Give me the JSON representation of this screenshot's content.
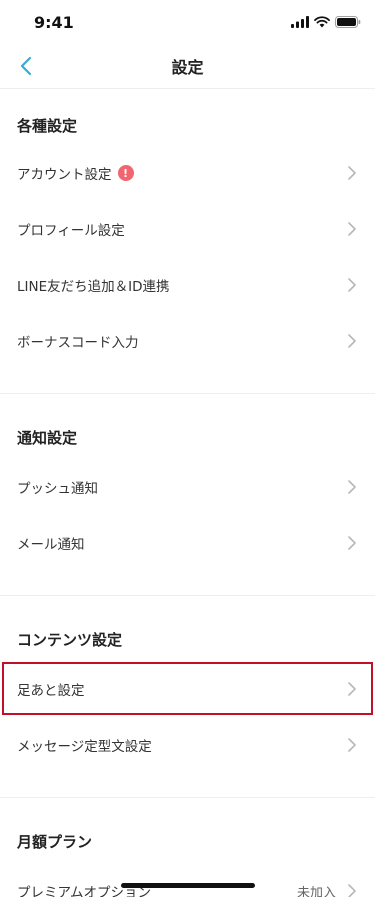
{
  "status_bar": {
    "time": "9:41"
  },
  "nav": {
    "title": "設定"
  },
  "sections": {
    "various": {
      "title": "各種設定",
      "items": [
        {
          "label": "アカウント設定",
          "alert": "!"
        },
        {
          "label": "プロフィール設定"
        },
        {
          "label": "LINE友だち追加＆ID連携"
        },
        {
          "label": "ボーナスコード入力"
        }
      ]
    },
    "notifications": {
      "title": "通知設定",
      "items": [
        {
          "label": "プッシュ通知"
        },
        {
          "label": "メール通知"
        }
      ]
    },
    "contents": {
      "title": "コンテンツ設定",
      "items": [
        {
          "label": "足あと設定",
          "highlighted": true
        },
        {
          "label": "メッセージ定型文設定"
        }
      ]
    },
    "monthly": {
      "title": "月額プラン",
      "items": [
        {
          "label": "プレミアムオプション",
          "value": "未加入"
        }
      ]
    }
  },
  "colors": {
    "accent": "#3aa8d8",
    "alert": "#f06570",
    "highlight_border": "#c0102a",
    "chevron": "#b8b8b8"
  },
  "icons": {
    "back": "chevron-left-icon",
    "row": "chevron-right-icon",
    "alert": "exclamation-icon"
  }
}
